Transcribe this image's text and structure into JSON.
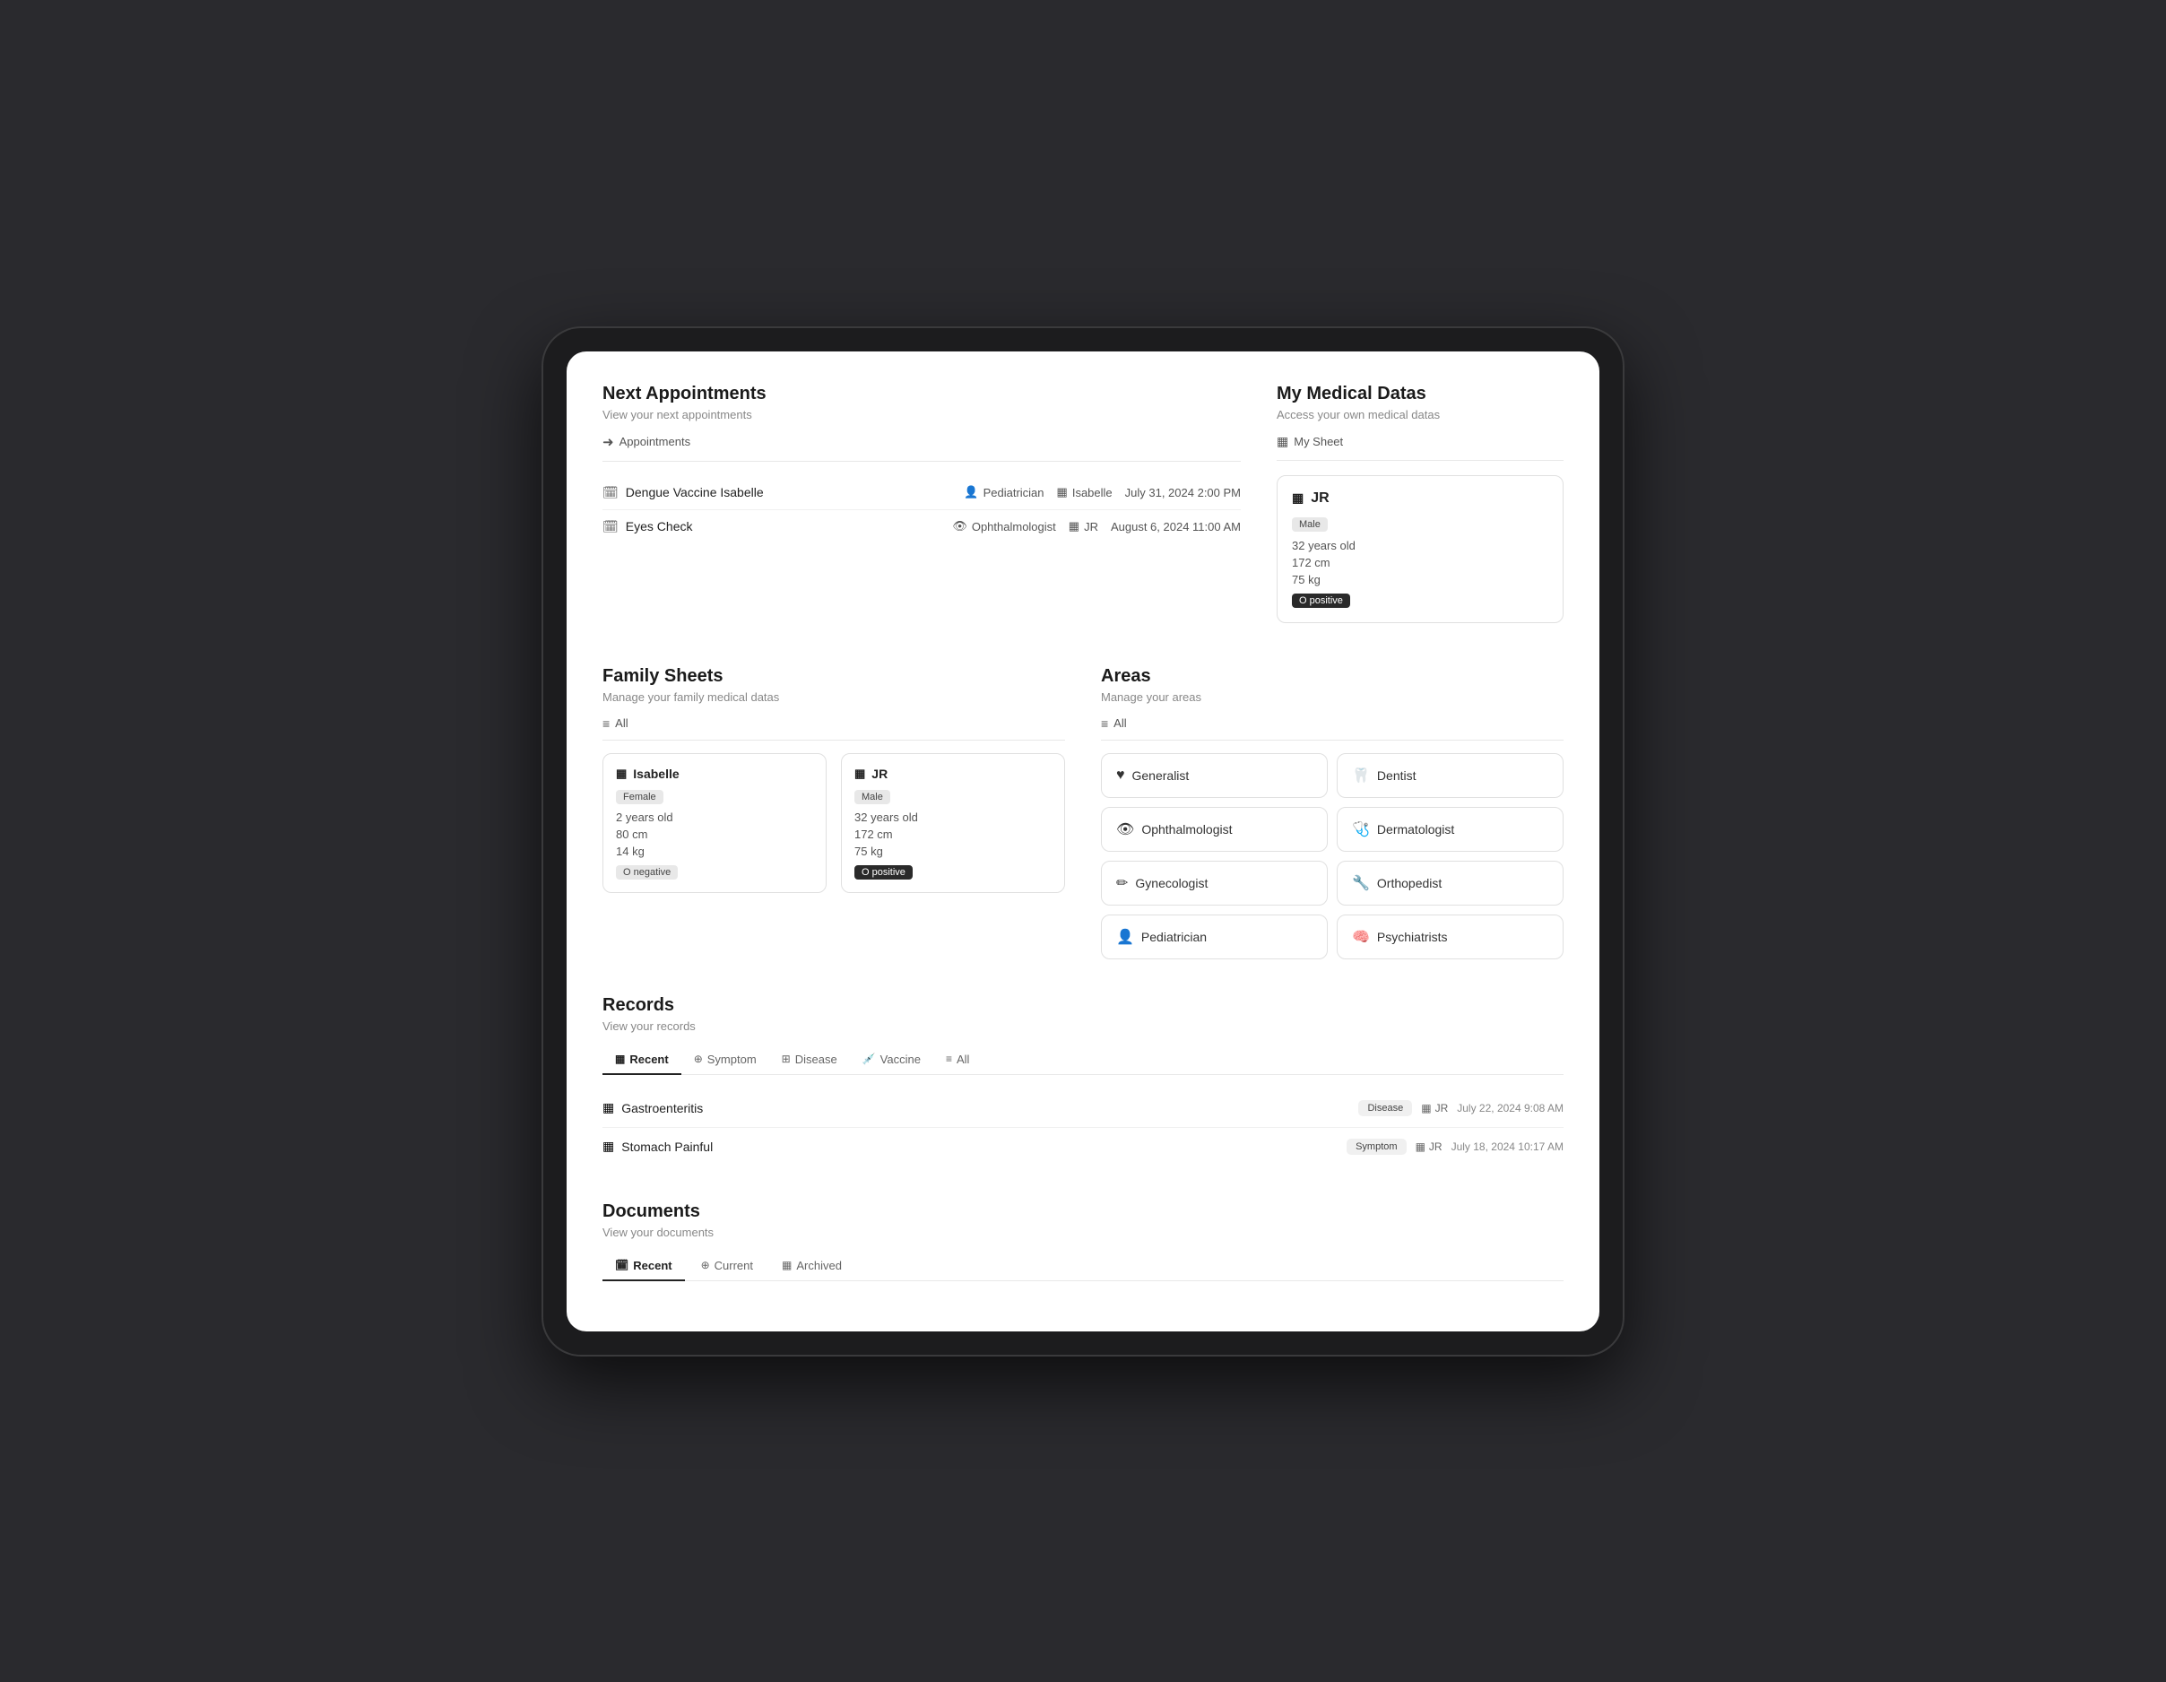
{
  "appointments": {
    "section_title": "Next Appointments",
    "section_subtitle": "View your next appointments",
    "link_label": "Appointments",
    "items": [
      {
        "title": "Dengue Vaccine Isabelle",
        "specialist_icon": "person-icon",
        "specialist": "Pediatrician",
        "person_icon": "card-icon",
        "person": "Isabelle",
        "date": "July 31, 2024 2:00 PM"
      },
      {
        "title": "Eyes Check",
        "specialist_icon": "eye-icon",
        "specialist": "Ophthalmologist",
        "person_icon": "card-icon",
        "person": "JR",
        "date": "August 6, 2024 11:00 AM"
      }
    ]
  },
  "medical_data": {
    "section_title": "My Medical Datas",
    "section_subtitle": "Access your own medical datas",
    "link_label": "My Sheet",
    "card": {
      "icon": "card-icon",
      "name": "JR",
      "gender": "Male",
      "age": "32 years old",
      "height": "172 cm",
      "weight": "75 kg",
      "blood_type": "O positive"
    }
  },
  "family_sheets": {
    "section_title": "Family Sheets",
    "section_subtitle": "Manage your family medical datas",
    "link_label": "All",
    "members": [
      {
        "icon": "card-icon",
        "name": "Isabelle",
        "gender": "Female",
        "age": "2 years old",
        "height": "80 cm",
        "weight": "14 kg",
        "blood_type": "O negative"
      },
      {
        "icon": "card-icon",
        "name": "JR",
        "gender": "Male",
        "age": "32 years old",
        "height": "172 cm",
        "weight": "75 kg",
        "blood_type": "O positive"
      }
    ]
  },
  "areas": {
    "section_title": "Areas",
    "section_subtitle": "Manage your areas",
    "link_label": "All",
    "items": [
      {
        "icon": "heart-icon",
        "label": "Generalist"
      },
      {
        "icon": "tooth-icon",
        "label": "Dentist"
      },
      {
        "icon": "eye-icon",
        "label": "Ophthalmologist"
      },
      {
        "icon": "skin-icon",
        "label": "Dermatologist"
      },
      {
        "icon": "gynec-icon",
        "label": "Gynecologist"
      },
      {
        "icon": "ortho-icon",
        "label": "Orthopedist"
      },
      {
        "icon": "pedi-icon",
        "label": "Pediatrician"
      },
      {
        "icon": "psych-icon",
        "label": "Psychiatrists"
      }
    ]
  },
  "records": {
    "section_title": "Records",
    "section_subtitle": "View your records",
    "tabs": [
      {
        "label": "Recent",
        "active": true
      },
      {
        "label": "Symptom",
        "active": false
      },
      {
        "label": "Disease",
        "active": false
      },
      {
        "label": "Vaccine",
        "active": false
      },
      {
        "label": "All",
        "active": false
      }
    ],
    "items": [
      {
        "icon": "record-icon",
        "title": "Gastroenteritis",
        "type": "Disease",
        "person": "JR",
        "date": "July 22, 2024 9:08 AM"
      },
      {
        "icon": "record-icon",
        "title": "Stomach Painful",
        "type": "Symptom",
        "person": "JR",
        "date": "July 18, 2024 10:17 AM"
      }
    ]
  },
  "documents": {
    "section_title": "Documents",
    "section_subtitle": "View your documents",
    "tabs": [
      {
        "label": "Recent",
        "active": true
      },
      {
        "label": "Current",
        "active": false
      },
      {
        "label": "Archived",
        "active": false
      }
    ]
  },
  "icons": {
    "arrow_right": "➜",
    "calendar": "📅",
    "list": "≡",
    "card": "▦",
    "eye": "👁",
    "person": "👤",
    "heart": "♥",
    "tooth": "🦷",
    "skin": "🩺",
    "pen": "✏",
    "needle": "💉",
    "brain": "🧠"
  }
}
